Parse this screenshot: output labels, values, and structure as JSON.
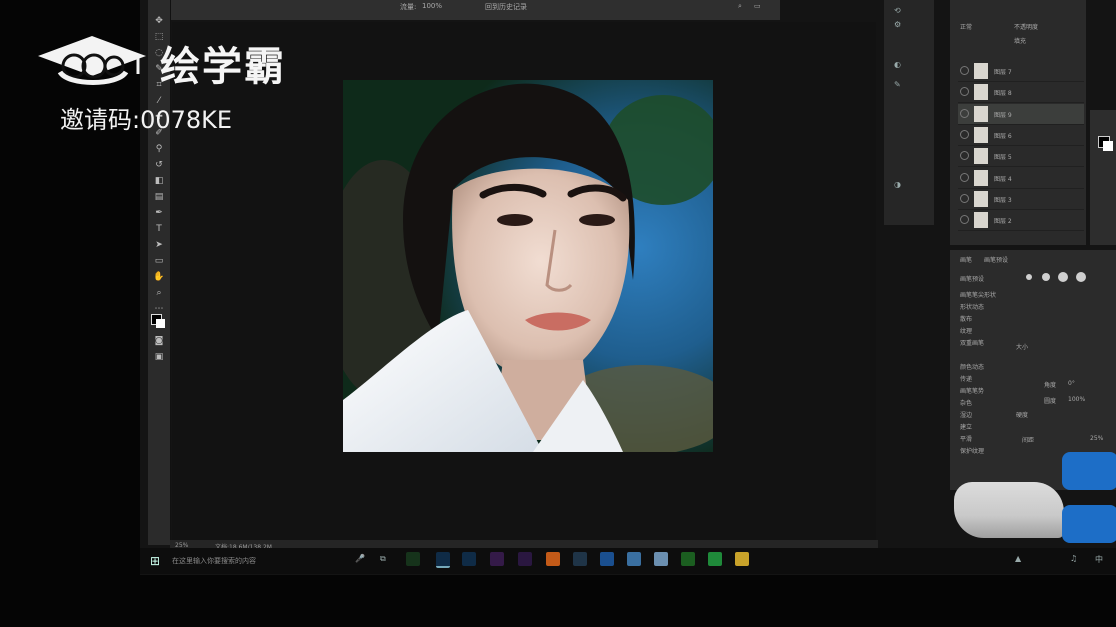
{
  "watermark": {
    "brand": "绘学霸",
    "invite": "邀请码:0078KE"
  },
  "options_bar": {
    "opacity_label": "流量:",
    "opacity_value": "100%",
    "history_label": "回到历史记录"
  },
  "status_bar": {
    "zoom": "25%",
    "doc_info": "文档:18.6M/138.2M"
  },
  "layers": [
    {
      "name": "图层 7",
      "selected": false
    },
    {
      "name": "图层 8",
      "selected": false
    },
    {
      "name": "图层 9",
      "selected": true
    },
    {
      "name": "图层 6",
      "selected": false
    },
    {
      "name": "图层 5",
      "selected": false
    },
    {
      "name": "图层 4",
      "selected": false
    },
    {
      "name": "图层 3",
      "selected": false
    },
    {
      "name": "图层 2",
      "selected": false
    }
  ],
  "layers_panel": {
    "blend_mode": "正常",
    "opacity_label": "不透明度",
    "fill_label": "填充"
  },
  "brush_panel": {
    "tab_brush": "画笔",
    "tab_preset": "画笔预设",
    "preset_button": "画笔预设",
    "tip_shape": "画笔笔尖形状",
    "options": [
      "形状动态",
      "散布",
      "纹理",
      "双重画笔",
      "颜色动态",
      "传递",
      "画笔笔势",
      "杂色",
      "湿边",
      "建立",
      "平滑",
      "保护纹理"
    ],
    "size_label": "大小",
    "angle_label": "角度",
    "roundness_label": "圆度",
    "hardness_label": "硬度",
    "spacing_label": "间距",
    "spacing_value": "25%",
    "angle_value": "0°",
    "roundness_value": "100%"
  },
  "taskbar": {
    "search_placeholder": "在这里输入你要搜索的内容"
  },
  "colors": {
    "accent_blue": "#1d6ec7",
    "panel_bg": "#2b2b2b",
    "screen_bg": "#141414"
  }
}
